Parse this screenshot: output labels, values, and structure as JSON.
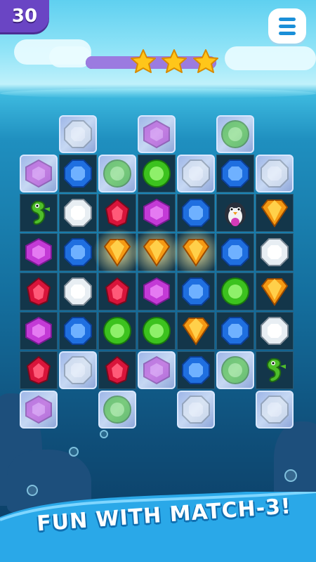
{
  "hud": {
    "moves_left": "30",
    "stars_earned": 3,
    "stars_total": 3,
    "progress": 1.0,
    "menu_icon": "hamburger-menu-icon"
  },
  "board": {
    "cols": 7,
    "rows": 8,
    "cells": [
      [
        null,
        "ice-blue-white",
        null,
        "ice-purple",
        null,
        "ice-green",
        null
      ],
      [
        "ice-purple",
        "blue",
        "ice-green",
        "green",
        "ice-white",
        "blue",
        "ice-blue-white"
      ],
      [
        "seahorse",
        "white",
        "red",
        "purple",
        "blue",
        "penguin",
        "orange"
      ],
      [
        "purple",
        "blue",
        "orange-glow",
        "orange-glow",
        "orange-glow",
        "blue",
        "white"
      ],
      [
        "red",
        "white",
        "red",
        "purple",
        "blue",
        "green",
        "orange"
      ],
      [
        "purple",
        "blue",
        "green",
        "green",
        "orange",
        "blue",
        "white"
      ],
      [
        "red",
        "ice-blue-white",
        "red",
        "ice-purple",
        "blue",
        "ice-green",
        "seahorse"
      ],
      [
        "ice-purple",
        null,
        "ice-green",
        null,
        "ice-white",
        null,
        "ice-blue-white"
      ]
    ]
  },
  "colors": {
    "purple": "#c33ad6",
    "blue": "#1f6fe0",
    "green": "#3cc21e",
    "red": "#d8143a",
    "white": "#e8eef3",
    "orange": "#f59a14"
  },
  "banner": {
    "text": "FUN WITH MATCH-3!"
  }
}
